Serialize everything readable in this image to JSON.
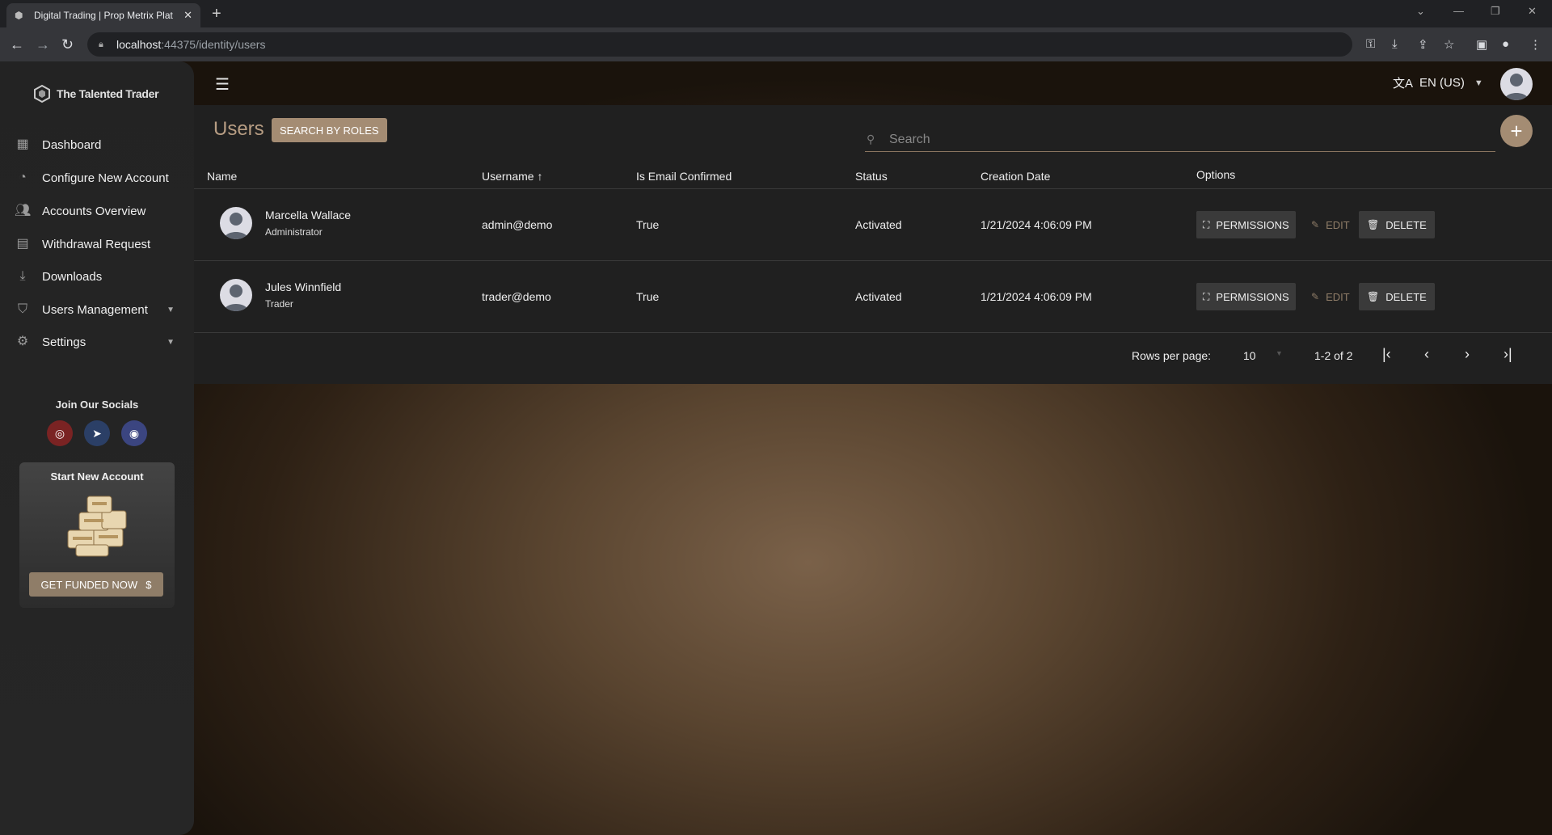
{
  "browser": {
    "tab_title": "Digital Trading | Prop Metrix Plat",
    "url_host": "localhost",
    "url_rest": ":44375/identity/users"
  },
  "sidebar": {
    "brand": "The Talented Trader",
    "items": [
      {
        "label": "Dashboard",
        "icon": "dashboard-icon"
      },
      {
        "label": "Configure New Account",
        "icon": "configure-icon"
      },
      {
        "label": "Accounts Overview",
        "icon": "accounts-icon"
      },
      {
        "label": "Withdrawal Request",
        "icon": "withdrawal-icon"
      },
      {
        "label": "Downloads",
        "icon": "download-icon"
      },
      {
        "label": "Users Management",
        "icon": "shield-icon"
      },
      {
        "label": "Settings",
        "icon": "gear-icon"
      }
    ],
    "socials_title": "Join Our Socials",
    "promo_title": "Start New Account",
    "promo_button": "GET FUNDED NOW",
    "promo_button_symbol": "$"
  },
  "topbar": {
    "language": "EN (US)"
  },
  "users_page": {
    "title": "Users",
    "search_by_roles": "SEARCH BY ROLES",
    "search_placeholder": "Search",
    "columns": [
      "Name",
      "Username",
      "Is Email Confirmed",
      "Status",
      "Creation Date",
      "Options"
    ],
    "sort_indicator": "↑",
    "rows": [
      {
        "name": "Marcella Wallace",
        "role": "Administrator",
        "username": "admin@demo",
        "email_confirmed": "True",
        "status": "Activated",
        "created": "1/21/2024 4:06:09 PM"
      },
      {
        "name": "Jules Winnfield",
        "role": "Trader",
        "username": "trader@demo",
        "email_confirmed": "True",
        "status": "Activated",
        "created": "1/21/2024 4:06:09 PM"
      }
    ],
    "actions": {
      "permissions": "PERMISSIONS",
      "edit": "EDIT",
      "delete": "DELETE"
    },
    "pagination": {
      "rows_per_page_label": "Rows per page:",
      "rows_per_page": "10",
      "range": "1-2 of 2"
    }
  },
  "colors": {
    "accent": "#a48c73",
    "title": "#b79d83",
    "panel": "#202020",
    "sidebar": "#242424"
  }
}
